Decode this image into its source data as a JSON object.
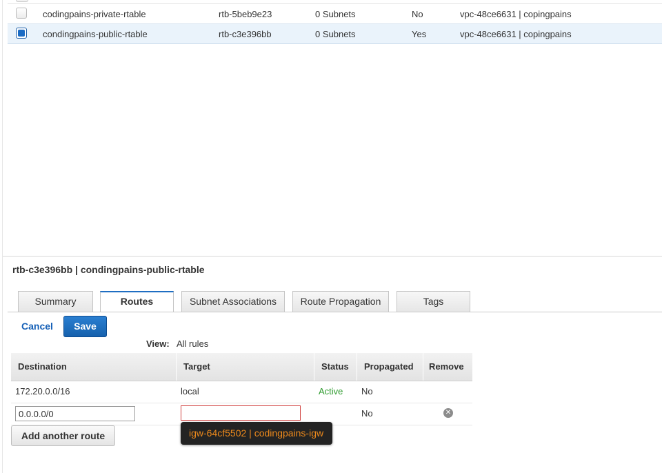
{
  "route_tables": [
    {
      "name": "codingpains-private-rtable",
      "id": "rtb-5beb9e23",
      "associations": "0 Subnets",
      "main": "No",
      "vpc": "vpc-48ce6631 | copingpains",
      "selected": false
    },
    {
      "name": "condingpains-public-rtable",
      "id": "rtb-c3e396bb",
      "associations": "0 Subnets",
      "main": "Yes",
      "vpc": "vpc-48ce6631 | copingpains",
      "selected": true
    }
  ],
  "detail": {
    "title": "rtb-c3e396bb | condingpains-public-rtable",
    "tabs": [
      {
        "label": "Summary",
        "active": false
      },
      {
        "label": "Routes",
        "active": true
      },
      {
        "label": "Subnet Associations",
        "active": false
      },
      {
        "label": "Route Propagation",
        "active": false
      },
      {
        "label": "Tags",
        "active": false
      }
    ],
    "cancel_label": "Cancel",
    "save_label": "Save",
    "view_label": "View:",
    "view_value": "All rules"
  },
  "routes": {
    "columns": [
      "Destination",
      "Target",
      "Status",
      "Propagated",
      "Remove"
    ],
    "existing": {
      "destination": "172.20.0.0/16",
      "target": "local",
      "status": "Active",
      "propagated": "No"
    },
    "new_route": {
      "destination_value": "0.0.0.0/0",
      "target_value": "",
      "propagated": "No"
    },
    "add_label": "Add another route",
    "suggestion": "igw-64cf5502 | codingpains-igw"
  },
  "colors": {
    "accent": "#1f6ec2",
    "status_active": "#2c9a2c",
    "suggestion_text": "#ee8a1c",
    "error_border": "#d0413e"
  }
}
